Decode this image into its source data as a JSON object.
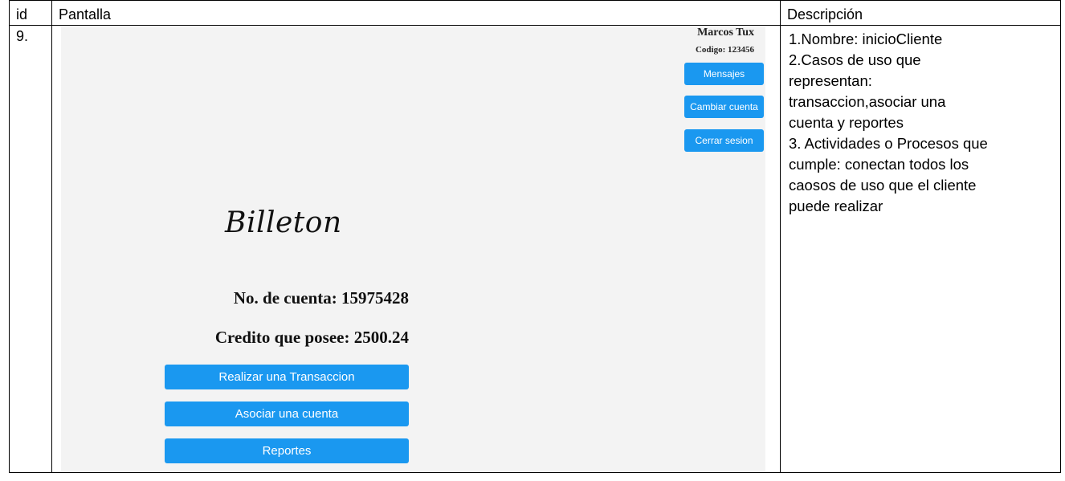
{
  "table": {
    "headers": {
      "id": "id",
      "screen": "Pantalla",
      "description": "Descripción"
    },
    "row": {
      "id": "9.",
      "description_lines": [
        "1.Nombre: inicioCliente",
        "2.Casos de uso que",
        "representan:",
        "transaccion,asociar una",
        "cuenta y reportes",
        "3. Actividades o Procesos que",
        "cumple: conectan todos los",
        "caosos de uso que el cliente",
        "puede realizar"
      ]
    }
  },
  "screen": {
    "user": {
      "name": "Marcos Tux",
      "code": "Codigo: 123456"
    },
    "side_buttons": {
      "messages": "Mensajes",
      "change_account": "Cambiar cuenta",
      "logout": "Cerrar sesion"
    },
    "logo": "Billeton",
    "account_number": "No. de cuenta: 15975428",
    "credit": "Credito que posee: 2500.24",
    "main_buttons": {
      "transaction": "Realizar una Transaccion",
      "associate": "Asociar una cuenta",
      "reports": "Reportes"
    },
    "colors": {
      "button": "#1a98f0",
      "screen_background": "#f3f3f3"
    }
  }
}
